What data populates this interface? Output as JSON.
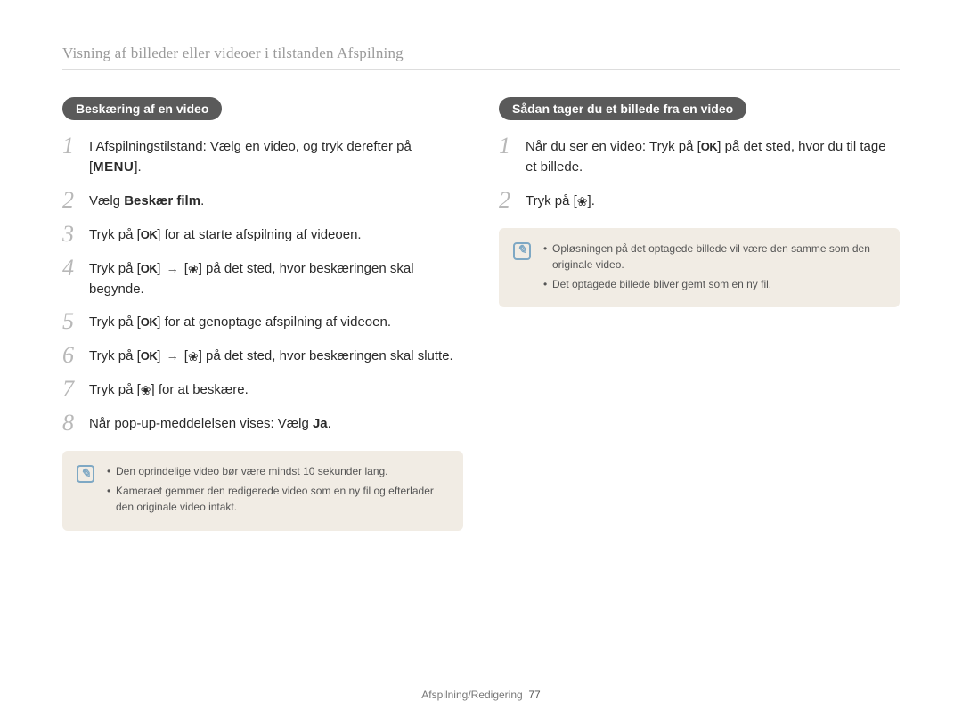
{
  "header": "Visning af billeder eller videoer i tilstanden Afspilning",
  "left": {
    "title": "Beskæring af en video",
    "steps": [
      {
        "n": "1",
        "html": "I Afspilningstilstand: Vælg en video, og tryk derefter på [<span class='menu-label'>MENU</span>]."
      },
      {
        "n": "2",
        "html": "Vælg <b>Beskær film</b>."
      },
      {
        "n": "3",
        "html": "Tryk på [<span class='ok-icon'>OK</span>] for at starte afspilning af videoen."
      },
      {
        "n": "4",
        "html": "Tryk på [<span class='ok-icon'>OK</span>] <span class='arrow'>→</span> [<span class='macro-icon'>❀</span>] på det sted, hvor beskæringen skal begynde."
      },
      {
        "n": "5",
        "html": "Tryk på [<span class='ok-icon'>OK</span>] for at genoptage afspilning af videoen."
      },
      {
        "n": "6",
        "html": "Tryk på [<span class='ok-icon'>OK</span>] <span class='arrow'>→</span> [<span class='macro-icon'>❀</span>] på det sted, hvor beskæringen skal slutte."
      },
      {
        "n": "7",
        "html": "Tryk på [<span class='macro-icon'>❀</span>] for at beskære."
      },
      {
        "n": "8",
        "html": "Når pop-up-meddelelsen vises: Vælg <b>Ja</b>."
      }
    ],
    "notes": [
      "Den oprindelige video bør være mindst 10 sekunder lang.",
      "Kameraet gemmer den redigerede video som en ny fil og efterlader den originale video intakt."
    ]
  },
  "right": {
    "title": "Sådan tager du et billede fra en video",
    "steps": [
      {
        "n": "1",
        "html": "Når du ser en video: Tryk på [<span class='ok-icon'>OK</span>] på det sted, hvor du til tage et billede."
      },
      {
        "n": "2",
        "html": "Tryk på [<span class='macro-icon'>❀</span>]."
      }
    ],
    "notes": [
      "Opløsningen på det optagede billede vil være den samme som den originale video.",
      "Det optagede billede bliver gemt som en ny fil."
    ]
  },
  "footer": {
    "section": "Afspilning/Redigering",
    "page": "77"
  },
  "note_icon_label": "✎"
}
